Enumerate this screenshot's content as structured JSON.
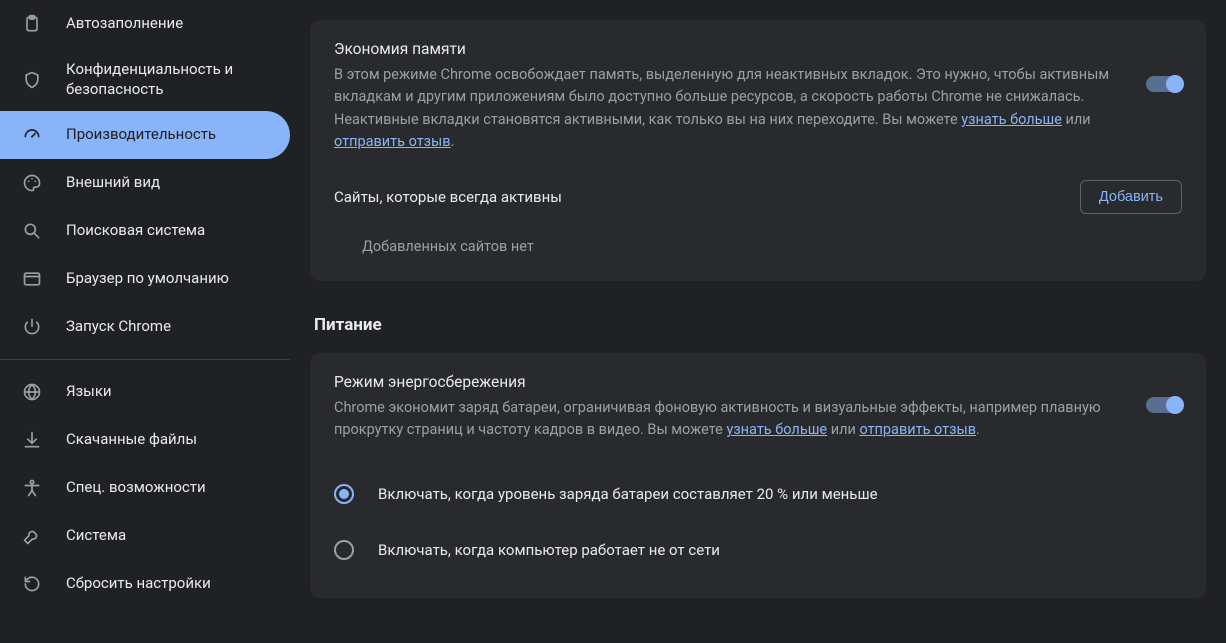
{
  "sidebar": {
    "items": [
      {
        "id": "autofill",
        "label": "Автозаполнение"
      },
      {
        "id": "privacy",
        "label": "Конфиденциальность и безопасность"
      },
      {
        "id": "performance",
        "label": "Производительность"
      },
      {
        "id": "appearance",
        "label": "Внешний вид"
      },
      {
        "id": "search",
        "label": "Поисковая система"
      },
      {
        "id": "default",
        "label": "Браузер по умолчанию"
      },
      {
        "id": "startup",
        "label": "Запуск Chrome"
      },
      {
        "id": "languages",
        "label": "Языки"
      },
      {
        "id": "downloads",
        "label": "Скачанные файлы"
      },
      {
        "id": "accessibility",
        "label": "Спец. возможности"
      },
      {
        "id": "system",
        "label": "Система"
      },
      {
        "id": "reset",
        "label": "Сбросить настройки"
      }
    ]
  },
  "memorySaver": {
    "title": "Экономия памяти",
    "desc_prefix": "В этом режиме Chrome освобождает память, выделенную для неактивных вкладок. Это нужно, чтобы активным вкладкам и другим приложениям было доступно больше ресурсов, а скорость работы Chrome не снижалась. Неактивные вкладки становятся активными, как только вы на них переходите. Вы можете ",
    "link_learn": "узнать больше",
    "desc_mid": " или ",
    "link_feedback": "отправить отзыв",
    "desc_suffix": ".",
    "enabled": true,
    "alwaysActive": {
      "title": "Сайты, которые всегда активны",
      "addButton": "Добавить",
      "empty": "Добавленных сайтов нет"
    }
  },
  "powerHeading": "Питание",
  "energySaver": {
    "title": "Режим энергосбережения",
    "desc_prefix": "Chrome экономит заряд батареи, ограничивая фоновую активность и визуальные эффекты, например плавную прокрутку страниц и частоту кадров в видео. Вы можете ",
    "link_learn": "узнать больше",
    "desc_mid": " или ",
    "link_feedback": "отправить отзыв",
    "desc_suffix": ".",
    "enabled": true,
    "options": [
      {
        "label": "Включать, когда уровень заряда батареи составляет 20 % или меньше",
        "checked": true
      },
      {
        "label": "Включать, когда компьютер работает не от сети",
        "checked": false
      }
    ]
  }
}
